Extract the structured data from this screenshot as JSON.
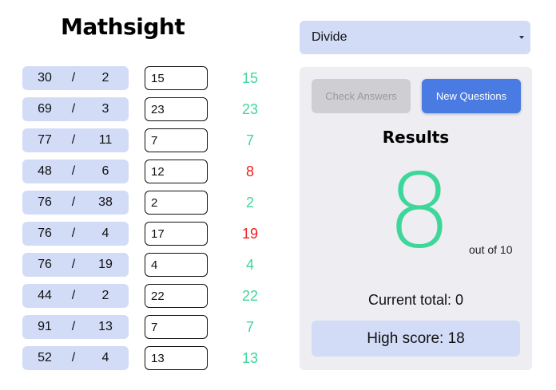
{
  "app": {
    "logo_text": "Mathsight"
  },
  "operation_select": {
    "value": "Divide"
  },
  "questions": [
    {
      "a": "30",
      "op": "/",
      "b": "2",
      "answer": "15",
      "correct": "15",
      "status": "right"
    },
    {
      "a": "69",
      "op": "/",
      "b": "3",
      "answer": "23",
      "correct": "23",
      "status": "right"
    },
    {
      "a": "77",
      "op": "/",
      "b": "11",
      "answer": "7",
      "correct": "7",
      "status": "right"
    },
    {
      "a": "48",
      "op": "/",
      "b": "6",
      "answer": "12",
      "correct": "8",
      "status": "wrong"
    },
    {
      "a": "76",
      "op": "/",
      "b": "38",
      "answer": "2",
      "correct": "2",
      "status": "right"
    },
    {
      "a": "76",
      "op": "/",
      "b": "4",
      "answer": "17",
      "correct": "19",
      "status": "wrong"
    },
    {
      "a": "76",
      "op": "/",
      "b": "19",
      "answer": "4",
      "correct": "4",
      "status": "right"
    },
    {
      "a": "44",
      "op": "/",
      "b": "2",
      "answer": "22",
      "correct": "22",
      "status": "right"
    },
    {
      "a": "91",
      "op": "/",
      "b": "13",
      "answer": "7",
      "correct": "7",
      "status": "right"
    },
    {
      "a": "52",
      "op": "/",
      "b": "4",
      "answer": "13",
      "correct": "13",
      "status": "right"
    }
  ],
  "colors": {
    "right": "#3ed79a",
    "wrong": "#f01d1d"
  },
  "controls": {
    "check_label": "Check Answers",
    "new_label": "New Questions"
  },
  "results": {
    "title": "Results",
    "score": "8",
    "out_of": "out of 10",
    "current_total": "Current total: 0",
    "high_score": "High score: 18"
  }
}
